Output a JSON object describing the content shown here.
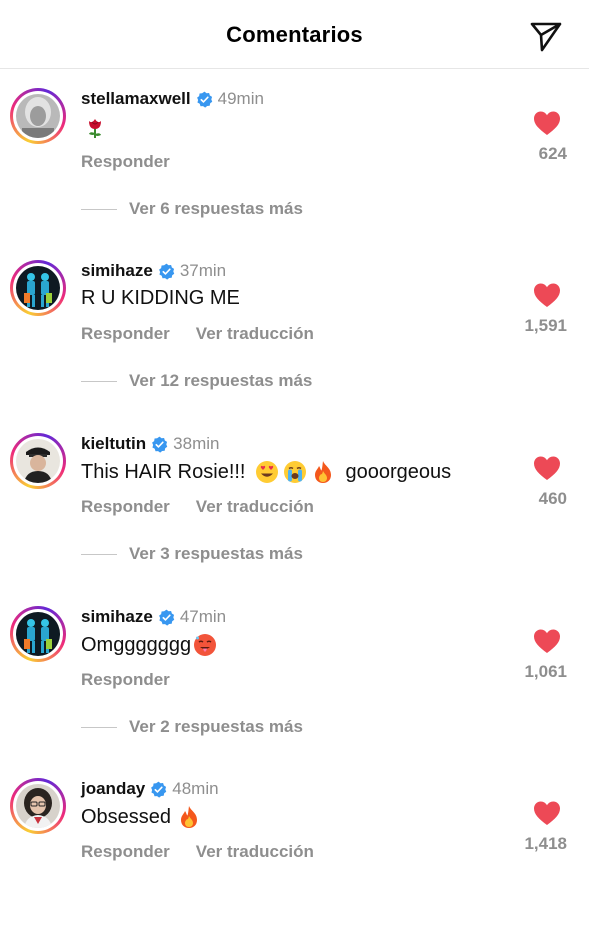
{
  "header": {
    "title": "Comentarios",
    "send_icon": "paper-plane-icon"
  },
  "colors": {
    "like": "#ed4956",
    "verified": "#3897f0",
    "secondary_text": "#8e8e8e"
  },
  "comments": [
    {
      "username": "stellamaxwell",
      "time": "49min",
      "text": "",
      "emoji_after": "rose",
      "actions": [
        "Responder"
      ],
      "likes": "624",
      "replies": "Ver 6 respuestas más",
      "verified": true
    },
    {
      "username": "simihaze",
      "time": "37min",
      "text": "R U KIDDING ME",
      "emoji_after": "",
      "actions": [
        "Responder",
        "Ver traducción"
      ],
      "likes": "1,591",
      "replies": "Ver 12 respuestas más",
      "verified": true
    },
    {
      "username": "kieltutin",
      "time": "38min",
      "text": "This HAIR Rosie!!!",
      "text_after": "gooorgeous",
      "emojis": [
        "heart-eyes-face",
        "crying-face",
        "fire"
      ],
      "actions": [
        "Responder",
        "Ver traducción"
      ],
      "likes": "460",
      "replies": "Ver 3 respuestas más",
      "verified": true
    },
    {
      "username": "simihaze",
      "time": "47min",
      "text": "Omggggggg",
      "emoji_after": "hot-face",
      "actions": [
        "Responder"
      ],
      "likes": "1,061",
      "replies": "Ver 2 respuestas más",
      "verified": true
    },
    {
      "username": "joanday",
      "time": "48min",
      "text": "Obsessed",
      "emoji_after": "fire",
      "actions": [
        "Responder",
        "Ver traducción"
      ],
      "likes": "1,418",
      "replies": "",
      "verified": true
    }
  ]
}
